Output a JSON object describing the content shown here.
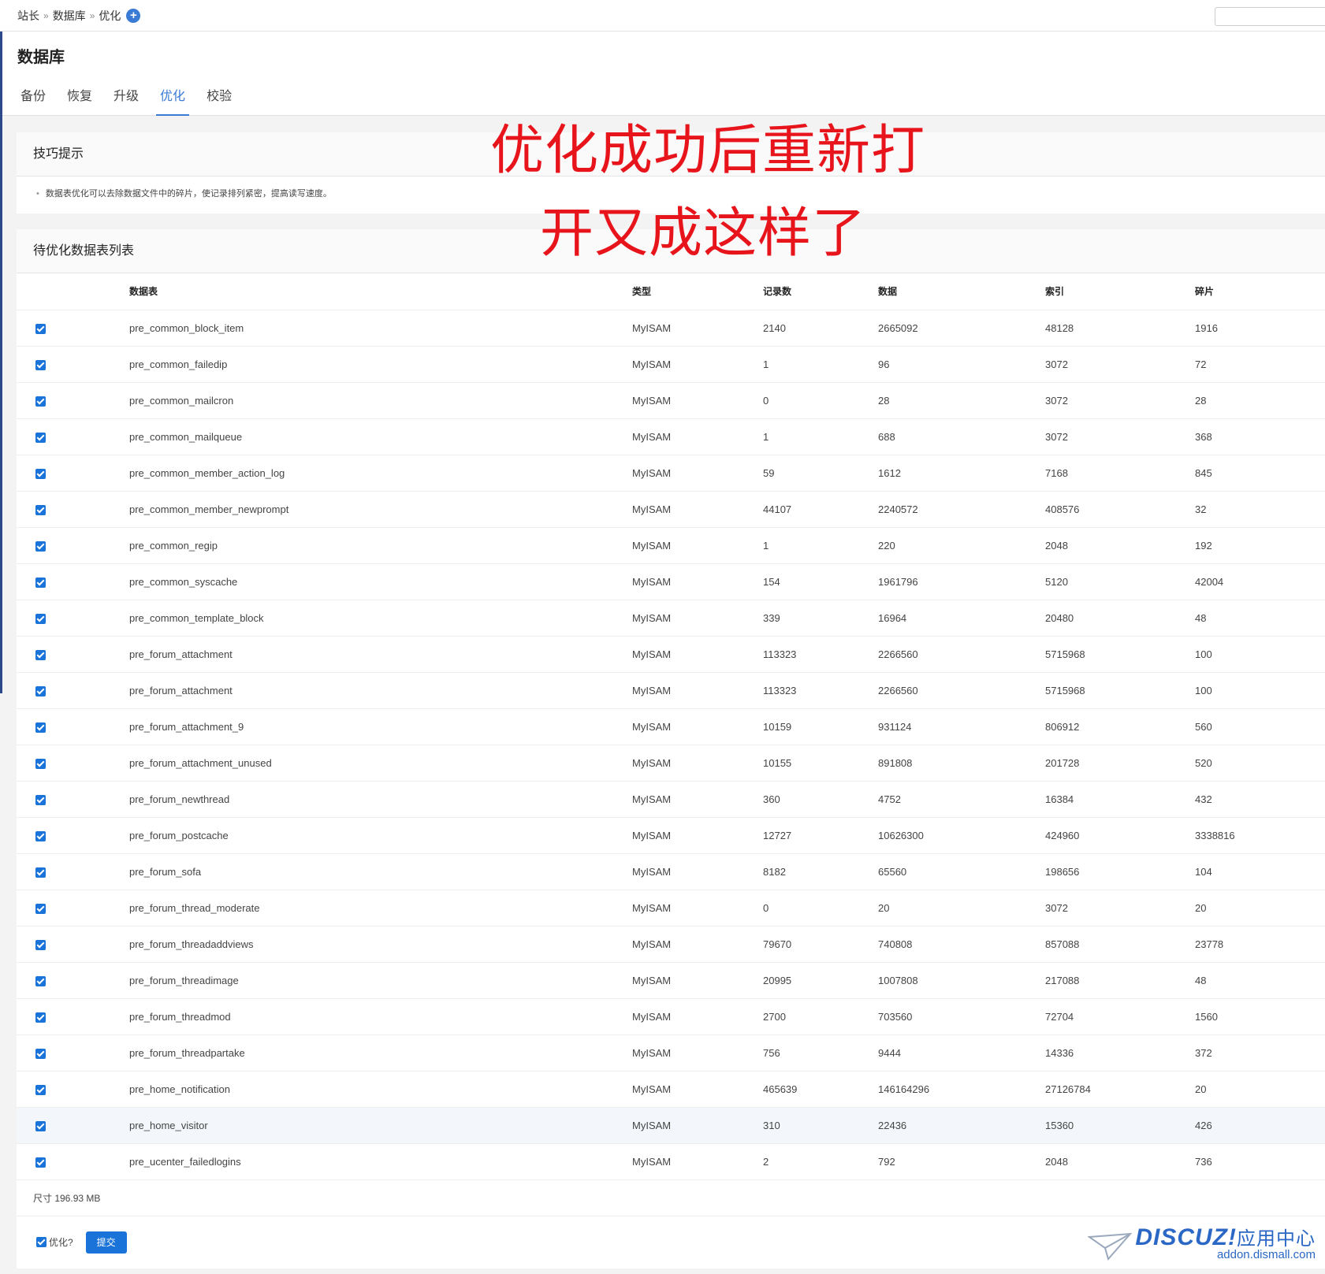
{
  "breadcrumb": [
    "站长",
    "数据库",
    "优化"
  ],
  "breadcrumb_sep": "»",
  "page_title": "数据库",
  "tabs": [
    {
      "label": "备份",
      "active": false
    },
    {
      "label": "恢复",
      "active": false
    },
    {
      "label": "升级",
      "active": false
    },
    {
      "label": "优化",
      "active": true
    },
    {
      "label": "校验",
      "active": false
    }
  ],
  "tips": {
    "title": "技巧提示",
    "text": "数据表优化可以去除数据文件中的碎片，使记录排列紧密，提高读写速度。"
  },
  "list": {
    "title": "待优化数据表列表",
    "columns": [
      "数据表",
      "类型",
      "记录数",
      "数据",
      "索引",
      "碎片"
    ],
    "rows": [
      [
        "pre_common_block_item",
        "MyISAM",
        "2140",
        "2665092",
        "48128",
        "1916"
      ],
      [
        "pre_common_failedip",
        "MyISAM",
        "1",
        "96",
        "3072",
        "72"
      ],
      [
        "pre_common_mailcron",
        "MyISAM",
        "0",
        "28",
        "3072",
        "28"
      ],
      [
        "pre_common_mailqueue",
        "MyISAM",
        "1",
        "688",
        "3072",
        "368"
      ],
      [
        "pre_common_member_action_log",
        "MyISAM",
        "59",
        "1612",
        "7168",
        "845"
      ],
      [
        "pre_common_member_newprompt",
        "MyISAM",
        "44107",
        "2240572",
        "408576",
        "32"
      ],
      [
        "pre_common_regip",
        "MyISAM",
        "1",
        "220",
        "2048",
        "192"
      ],
      [
        "pre_common_syscache",
        "MyISAM",
        "154",
        "1961796",
        "5120",
        "42004"
      ],
      [
        "pre_common_template_block",
        "MyISAM",
        "339",
        "16964",
        "20480",
        "48"
      ],
      [
        "pre_forum_attachment",
        "MyISAM",
        "113323",
        "2266560",
        "5715968",
        "100"
      ],
      [
        "pre_forum_attachment",
        "MyISAM",
        "113323",
        "2266560",
        "5715968",
        "100"
      ],
      [
        "pre_forum_attachment_9",
        "MyISAM",
        "10159",
        "931124",
        "806912",
        "560"
      ],
      [
        "pre_forum_attachment_unused",
        "MyISAM",
        "10155",
        "891808",
        "201728",
        "520"
      ],
      [
        "pre_forum_newthread",
        "MyISAM",
        "360",
        "4752",
        "16384",
        "432"
      ],
      [
        "pre_forum_postcache",
        "MyISAM",
        "12727",
        "10626300",
        "424960",
        "3338816"
      ],
      [
        "pre_forum_sofa",
        "MyISAM",
        "8182",
        "65560",
        "198656",
        "104"
      ],
      [
        "pre_forum_thread_moderate",
        "MyISAM",
        "0",
        "20",
        "3072",
        "20"
      ],
      [
        "pre_forum_threadaddviews",
        "MyISAM",
        "79670",
        "740808",
        "857088",
        "23778"
      ],
      [
        "pre_forum_threadimage",
        "MyISAM",
        "20995",
        "1007808",
        "217088",
        "48"
      ],
      [
        "pre_forum_threadmod",
        "MyISAM",
        "2700",
        "703560",
        "72704",
        "1560"
      ],
      [
        "pre_forum_threadpartake",
        "MyISAM",
        "756",
        "9444",
        "14336",
        "372"
      ],
      [
        "pre_home_notification",
        "MyISAM",
        "465639",
        "146164296",
        "27126784",
        "20"
      ],
      [
        "pre_home_visitor",
        "MyISAM",
        "310",
        "22436",
        "15360",
        "426"
      ],
      [
        "pre_ucenter_failedlogins",
        "MyISAM",
        "2",
        "792",
        "2048",
        "736"
      ]
    ],
    "size_text": "尺寸 196.93 MB",
    "optimize_label": "优化?",
    "submit_label": "提交"
  },
  "annotation": {
    "line1": "优化成功后重新打",
    "line2": "开又成这样了",
    "color": "#e8141c"
  },
  "watermark": {
    "brand": "DISCUZ!",
    "brand_zh": "应用中心",
    "url": "addon.dismall.com"
  },
  "colors": {
    "accent": "#1a73d8",
    "tab_active": "#3a7bd5"
  }
}
